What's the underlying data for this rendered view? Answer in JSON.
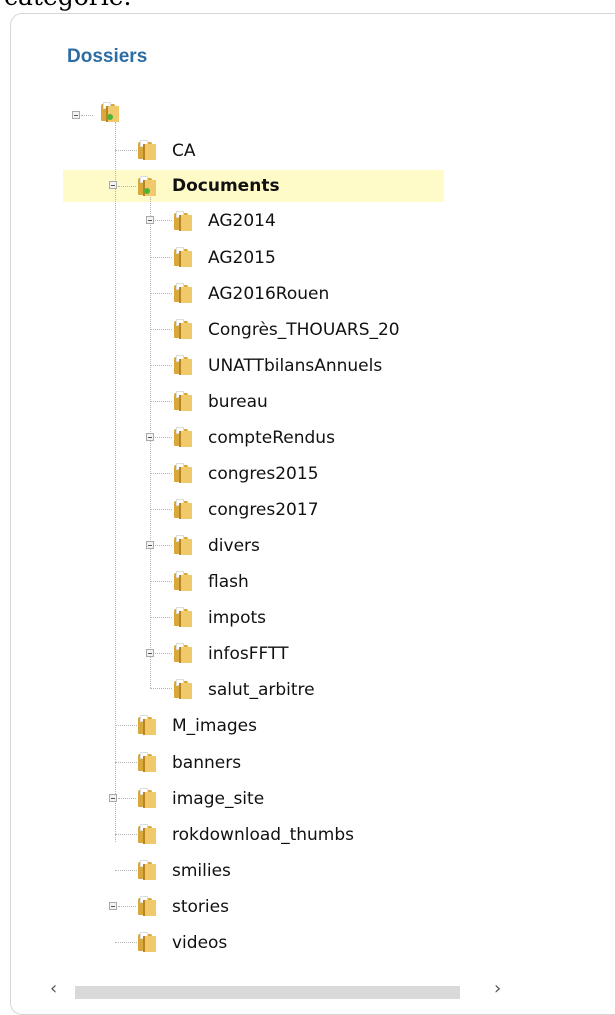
{
  "top_fragment": "catégorie.",
  "panel": {
    "title": "Dossiers"
  },
  "tree": {
    "root": {
      "label": "",
      "state": "expanded"
    },
    "items": [
      {
        "label": "CA"
      },
      {
        "label": "Documents",
        "state": "expanded",
        "selected": true
      },
      {
        "label": "AG2014",
        "state": "collapsed"
      },
      {
        "label": "AG2015"
      },
      {
        "label": "AG2016Rouen"
      },
      {
        "label": "Congrès_THOUARS_20"
      },
      {
        "label": "UNATTbilansAnnuels"
      },
      {
        "label": "bureau"
      },
      {
        "label": "compteRendus",
        "state": "collapsed"
      },
      {
        "label": "congres2015"
      },
      {
        "label": "congres2017"
      },
      {
        "label": "divers",
        "state": "collapsed"
      },
      {
        "label": "flash"
      },
      {
        "label": "impots"
      },
      {
        "label": "infosFFTT",
        "state": "collapsed"
      },
      {
        "label": "salut_arbitre"
      },
      {
        "label": "M_images"
      },
      {
        "label": "banners"
      },
      {
        "label": "image_site",
        "state": "collapsed"
      },
      {
        "label": "rokdownload_thumbs"
      },
      {
        "label": "smilies"
      },
      {
        "label": "stories",
        "state": "collapsed"
      },
      {
        "label": "videos"
      }
    ]
  },
  "scrollbar": {
    "left_arrow": "‹",
    "right_arrow": "›"
  }
}
